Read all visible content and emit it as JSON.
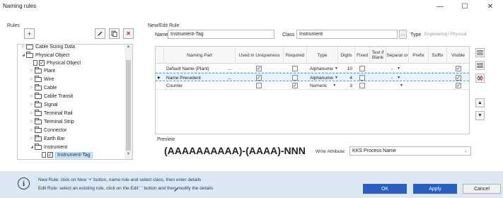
{
  "window": {
    "title": "Naming rules",
    "minimize": "—",
    "maximize": "☐",
    "close": "✕"
  },
  "left": {
    "section_label": "Rules",
    "add_label": "+",
    "tree": [
      {
        "label": "Cable Sizing Data"
      },
      {
        "label": "Physical Object"
      },
      {
        "label": "Physical Object"
      },
      {
        "label": "Plant"
      },
      {
        "label": "Wire"
      },
      {
        "label": "Cable"
      },
      {
        "label": "Cable Transit"
      },
      {
        "label": "Signal"
      },
      {
        "label": "Terminal Rail"
      },
      {
        "label": "Terminal Strip"
      },
      {
        "label": "Connector"
      },
      {
        "label": "Earth Bar"
      },
      {
        "label": "Instrument"
      },
      {
        "label": "Instrument-Tag"
      }
    ]
  },
  "right": {
    "section_label": "New/Edit Rule",
    "name_label": "Name",
    "name_value": "Instrument-Tag",
    "class_label": "Class",
    "class_value": "Instrument",
    "class_browse": "...",
    "type_label": "Type",
    "type_value": "Engineering / Physical",
    "columns": [
      "Naming Part",
      "Used in Uniqueness",
      "Required",
      "Type",
      "Digits",
      "Fixed",
      "Text if Blank",
      "Separat or",
      "Prefix",
      "Suffix",
      "Visible"
    ],
    "rows": [
      {
        "pointer": "",
        "part": "Default Name (Plant)",
        "more": "...",
        "type": "Alphanume",
        "digits": "10",
        "separator": "-"
      },
      {
        "pointer": "▶",
        "part": "Name Precedent",
        "more": "...",
        "type": "Alphanume",
        "digits": "4",
        "separator": "-"
      },
      {
        "pointer": "",
        "part": "Counter",
        "more": "",
        "type": "Numeric",
        "digits": "3",
        "separator": ""
      }
    ],
    "preview_label": "Preview",
    "preview_value": "(AAAAAAAAAA)-(AAAA)-NNN",
    "write_attr_label": "Write Attribute:",
    "write_attr_value": "KKS Process Name"
  },
  "footer": {
    "help_line1": "New Rule: click on New '+' button, name rule and select class, then enter details",
    "help_line2": "Edit Rule: select an existing rule, click on the Edit '  ' button and then modify the details",
    "ok": "OK",
    "apply": "Apply",
    "cancel": "Cancel"
  }
}
